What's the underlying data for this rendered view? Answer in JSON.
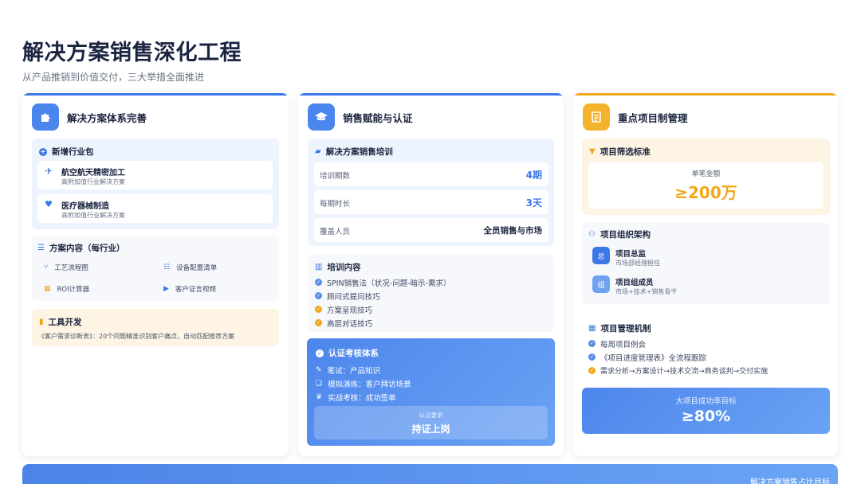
{
  "page": {
    "title": "解决方案销售深化工程",
    "subtitle": "从产品推销到价值交付，三大举措全面推进"
  },
  "col1": {
    "title": "解决方案体系完善",
    "icon": "puzzle-icon",
    "accent": "#3c78e6",
    "industry": {
      "title": "新增行业包",
      "items": [
        {
          "name": "航空航天精密加工",
          "desc": "高附加值行业解决方案",
          "icon": "airplane-icon"
        },
        {
          "name": "医疗器械制造",
          "desc": "高附加值行业解决方案",
          "icon": "heart-pulse-icon"
        }
      ]
    },
    "content": {
      "title": "方案内容（每行业）",
      "items": [
        {
          "label": "工艺流程图",
          "icon": "flow-icon"
        },
        {
          "label": "设备配置清单",
          "icon": "list-icon"
        },
        {
          "label": "ROI计算器",
          "icon": "calculator-icon"
        },
        {
          "label": "客户证言视频",
          "icon": "video-icon"
        }
      ]
    },
    "tool": {
      "title": "工具开发",
      "desc": "《客户需求诊断表》：20个问题精准识别客户痛点，自动匹配推荐方案"
    }
  },
  "col2": {
    "title": "销售赋能与认证",
    "icon": "graduation-cap-icon",
    "accent": "#3c78e6",
    "training": {
      "title": "解决方案销售培训",
      "rows": [
        {
          "label": "培训期数",
          "value": "4期"
        },
        {
          "label": "每期时长",
          "value": "3天"
        },
        {
          "label": "覆盖人员",
          "value": "全员销售与市场"
        }
      ]
    },
    "content": {
      "title": "培训内容",
      "items": [
        "SPIN销售法（状况-问题-暗示-需求）",
        "顾问式提问技巧",
        "方案呈现技巧",
        "高层对话技巧"
      ]
    },
    "cert": {
      "title": "认证考核体系",
      "items": [
        {
          "label": "笔试：产品知识",
          "icon": "pen-icon"
        },
        {
          "label": "模拟演练：客户拜访场景",
          "icon": "chat-icon"
        },
        {
          "label": "实战考核：成功签单",
          "icon": "trophy-icon"
        }
      ],
      "req_label": "认证要求",
      "req_value": "持证上岗"
    }
  },
  "col3": {
    "title": "重点项目制管理",
    "icon": "checklist-icon",
    "accent": "#f0a818",
    "screen": {
      "title": "项目筛选标准",
      "label": "单笔金额",
      "value": "≥200万"
    },
    "org": {
      "title": "项目组织架构",
      "members": [
        {
          "badge": "总",
          "name": "项目总监",
          "desc": "市场部经理担任"
        },
        {
          "badge": "组",
          "name": "项目组成员",
          "desc": "市场+技术+销售骨干"
        }
      ]
    },
    "mech": {
      "title": "项目管理机制",
      "items": [
        "每周项目例会",
        "《项目进度管理表》全流程跟踪",
        "需求分析→方案设计→技术交流→商务谈判→交付实施"
      ]
    },
    "goal": {
      "label": "大项目成功率目标",
      "value": "≥80%"
    }
  },
  "bottom": {
    "text": "解决方案销售占比目标"
  }
}
